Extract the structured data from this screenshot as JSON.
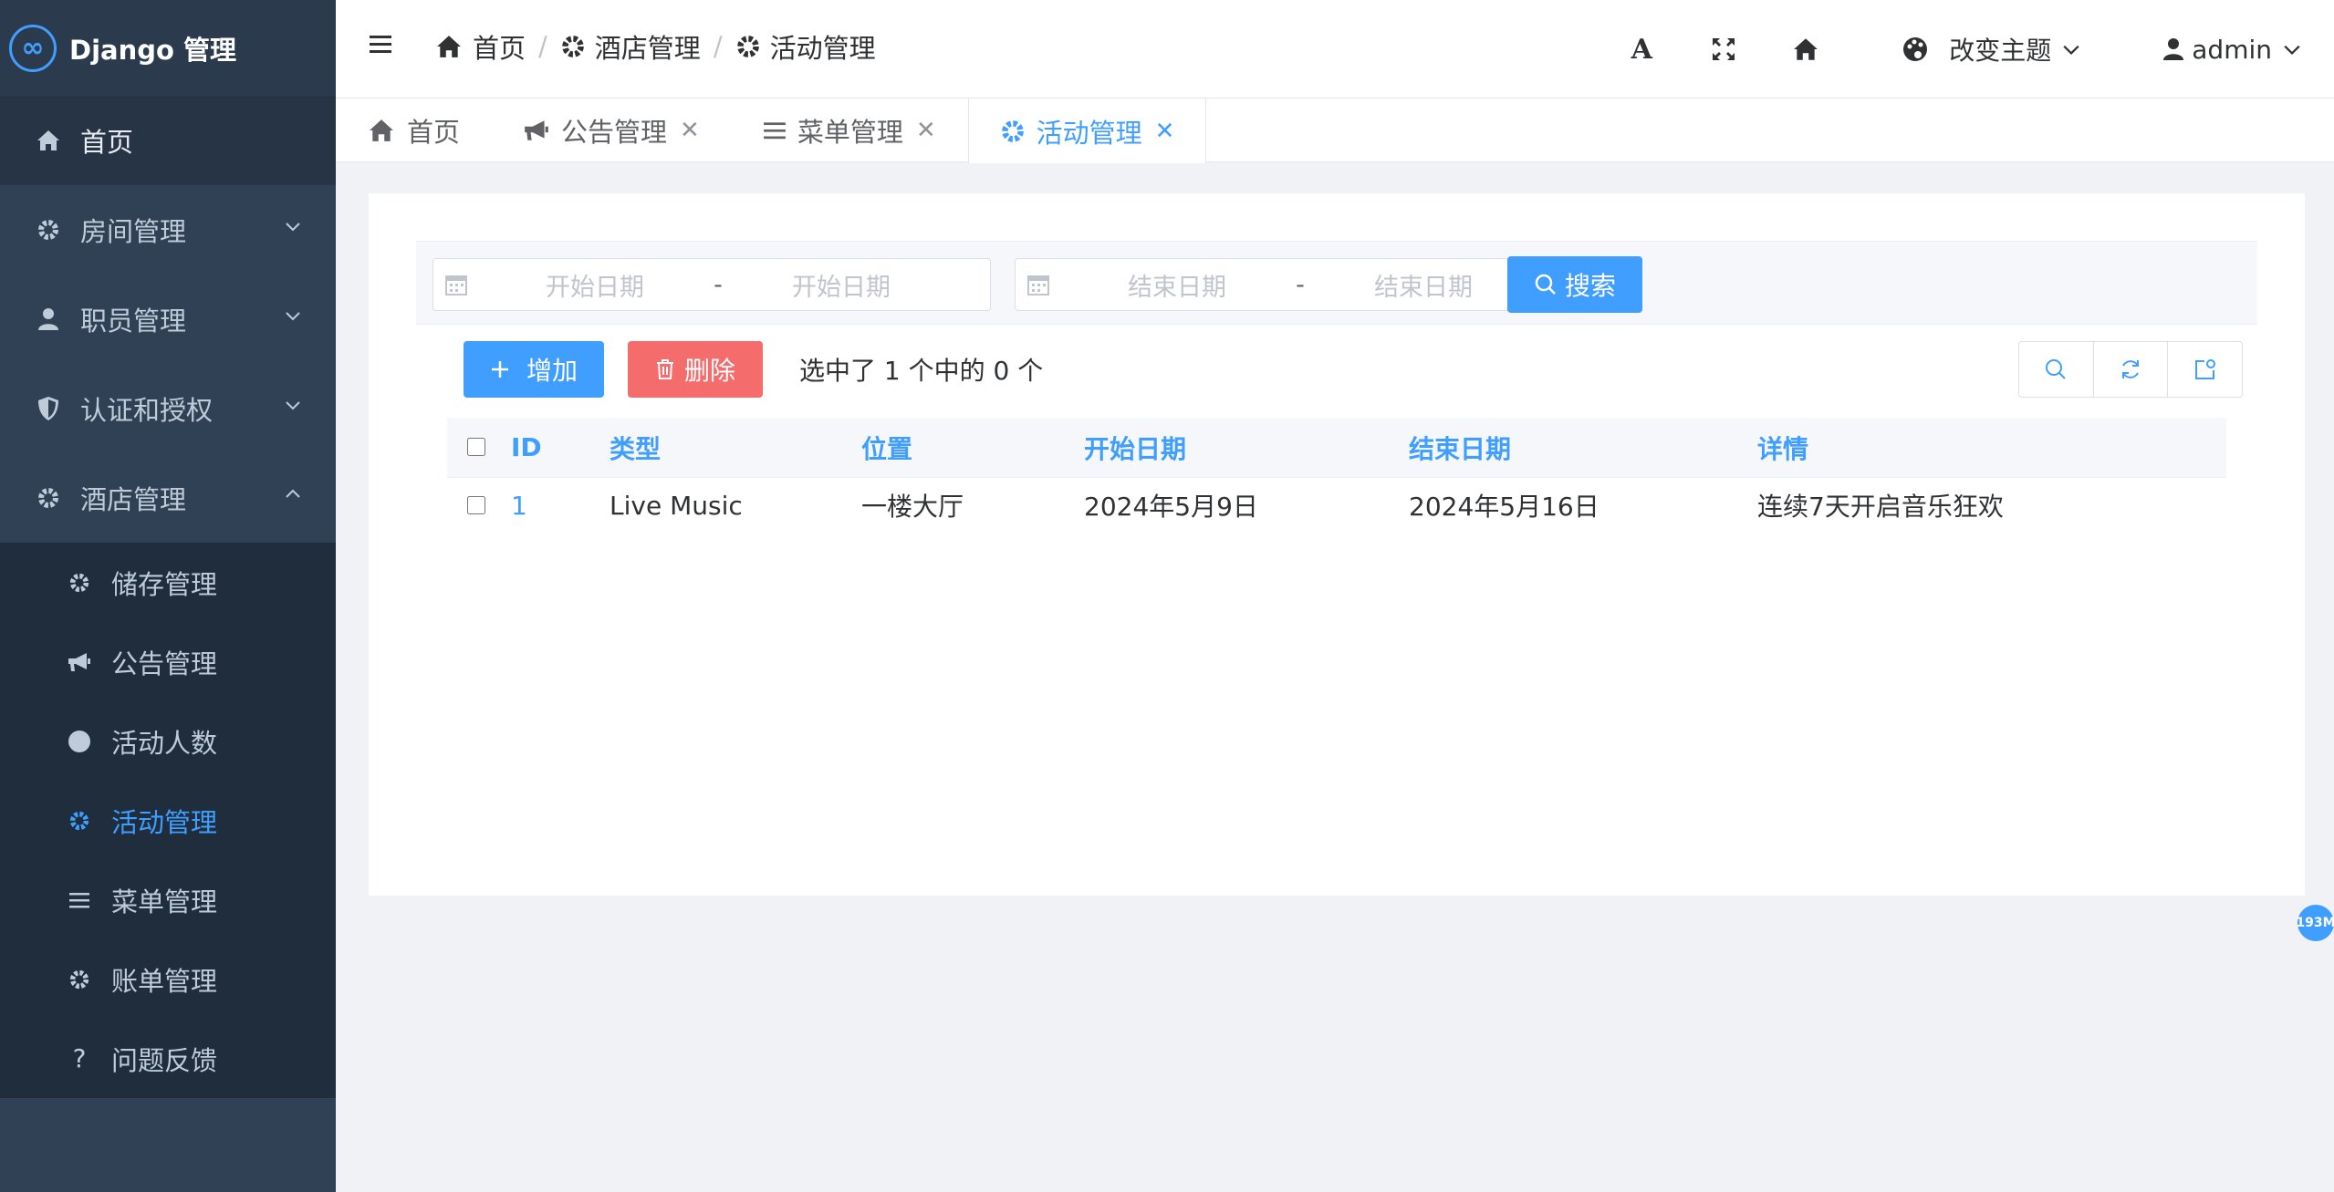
{
  "brand": {
    "logo": "∞",
    "title": "Django 管理"
  },
  "sidebar": {
    "items": [
      {
        "label": "首页",
        "icon": "home-icon"
      },
      {
        "label": "房间管理",
        "icon": "gear-icon"
      },
      {
        "label": "职员管理",
        "icon": "user-icon"
      },
      {
        "label": "认证和授权",
        "icon": "shield-icon"
      },
      {
        "label": "酒店管理",
        "icon": "gear-icon"
      }
    ],
    "submenu": [
      {
        "label": "储存管理",
        "icon": "gear-icon"
      },
      {
        "label": "公告管理",
        "icon": "bullhorn-icon"
      },
      {
        "label": "活动人数",
        "icon": "circle-icon"
      },
      {
        "label": "活动管理",
        "icon": "gear-icon",
        "active": true
      },
      {
        "label": "菜单管理",
        "icon": "list-icon"
      },
      {
        "label": "账单管理",
        "icon": "gear-icon"
      },
      {
        "label": "问题反馈",
        "icon": "question-icon"
      }
    ]
  },
  "header": {
    "breadcrumb": [
      "首页",
      "酒店管理",
      "活动管理"
    ],
    "theme_label": "改变主题",
    "user_label": "admin"
  },
  "tabs": [
    {
      "label": "首页",
      "closable": false
    },
    {
      "label": "公告管理",
      "closable": true
    },
    {
      "label": "菜单管理",
      "closable": true
    },
    {
      "label": "活动管理",
      "closable": true,
      "active": true
    }
  ],
  "filters": {
    "start_from_placeholder": "开始日期",
    "start_to_placeholder": "开始日期",
    "end_from_placeholder": "结束日期",
    "end_to_placeholder": "结束日期",
    "dash": "-",
    "search_label": "搜索"
  },
  "toolbar": {
    "add_label": "增加",
    "delete_label": "删除",
    "selection_text": "选中了 1 个中的 0 个"
  },
  "table": {
    "columns": [
      "ID",
      "类型",
      "位置",
      "开始日期",
      "结束日期",
      "详情"
    ],
    "rows": [
      [
        "1",
        "Live Music",
        "一楼大厅",
        "2024年5月9日",
        "2024年5月16日",
        "连续7天开启音乐狂欢"
      ]
    ]
  },
  "memory_badge": "193M",
  "colors": {
    "primary": "#409eff",
    "danger": "#f56c6c",
    "sidebar_bg": "#304156"
  }
}
